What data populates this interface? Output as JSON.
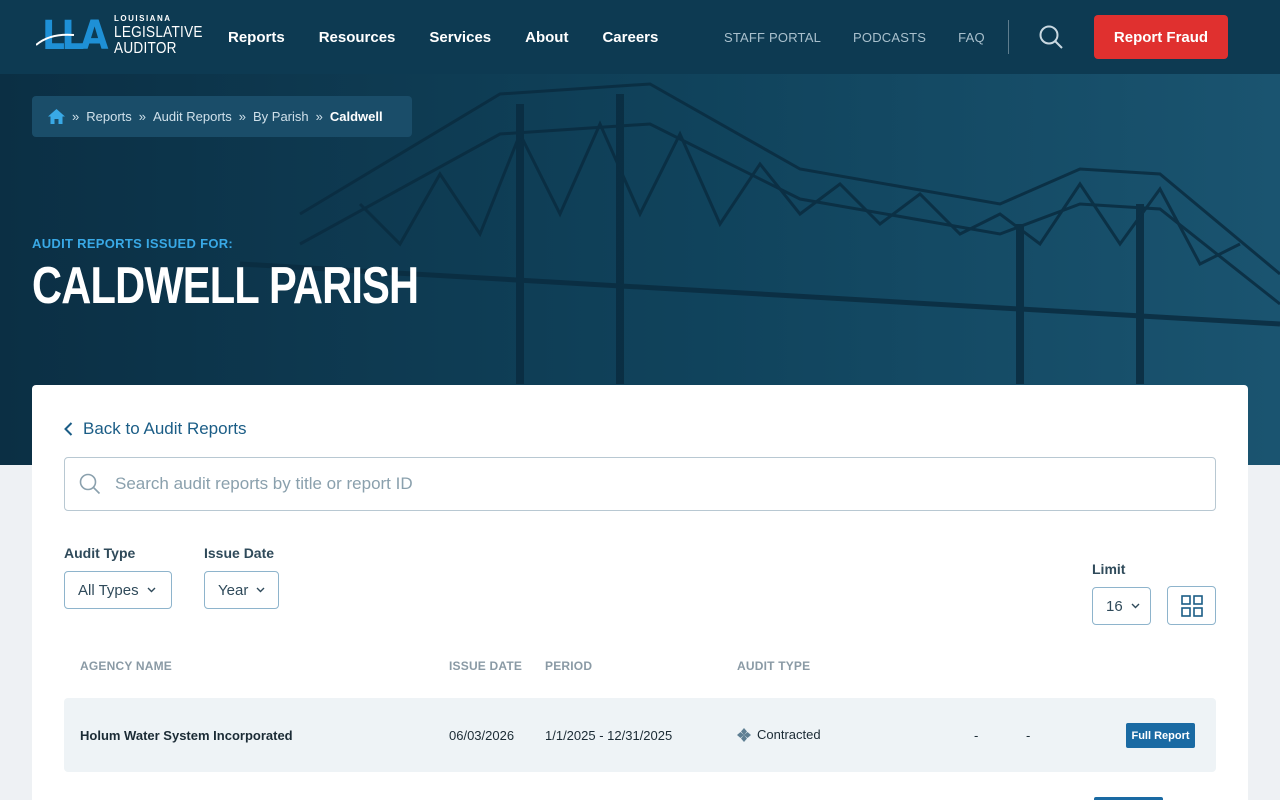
{
  "logo": {
    "small": "LOUISIANA",
    "line1": "LEGISLATIVE",
    "line2": "AUDITOR",
    "mark": "LLA"
  },
  "nav": {
    "main": [
      "Reports",
      "Resources",
      "Services",
      "About",
      "Careers"
    ],
    "utility": [
      "STAFF PORTAL",
      "PODCASTS",
      "FAQ"
    ],
    "report_fraud": "Report Fraud"
  },
  "breadcrumb": {
    "items": [
      "Reports",
      "Audit Reports",
      "By Parish"
    ],
    "current": "Caldwell",
    "separator": "»"
  },
  "hero": {
    "eyebrow": "AUDIT REPORTS ISSUED FOR:",
    "title": "CALDWELL PARISH"
  },
  "back_link": "Back to Audit Reports",
  "search": {
    "placeholder": "Search audit reports by title or report ID",
    "value": ""
  },
  "filters": {
    "audit_type": {
      "label": "Audit Type",
      "value": "All Types"
    },
    "issue_date": {
      "label": "Issue Date",
      "value": "Year"
    },
    "limit": {
      "label": "Limit",
      "value": "16"
    }
  },
  "table": {
    "headers": [
      "AGENCY NAME",
      "ISSUE DATE",
      "PERIOD",
      "AUDIT TYPE"
    ],
    "rows": [
      {
        "agency": "Holum Water System Incorporated",
        "issue_date": "06/03/2026",
        "period": "1/1/2025 - 12/31/2025",
        "audit_type": "Contracted",
        "col5": "-",
        "col6": "-",
        "action": "Full Report"
      }
    ]
  },
  "colors": {
    "header_bg": "#0d3a52",
    "accent": "#1e90d6",
    "fraud_button": "#e0302f",
    "action_button": "#1a6aa3"
  }
}
